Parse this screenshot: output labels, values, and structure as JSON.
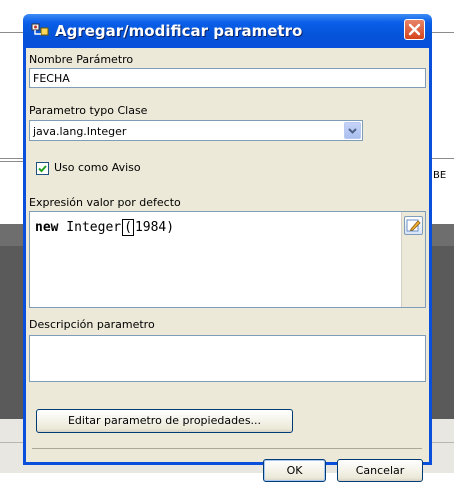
{
  "background": {
    "side_text": "BE"
  },
  "dialog": {
    "title": "Agregar/modificar parametro",
    "close_icon": "close-icon",
    "param_name": {
      "label": "Nombre Parámetro",
      "value": "FECHA"
    },
    "param_type": {
      "label": "Parametro typo Clase",
      "value": "java.lang.Integer"
    },
    "use_as_alert": {
      "label": "Uso como Aviso",
      "checked": true
    },
    "default_expr": {
      "label": "Expresión valor por defecto",
      "keyword": "new",
      "before_caret": " Integer",
      "caret_char": "(",
      "after_caret": "1984)"
    },
    "description": {
      "label": "Descripción parametro",
      "value": ""
    },
    "edit_properties_label": "Editar parametro de propiedades...",
    "ok_label": "OK",
    "cancel_label": "Cancelar"
  },
  "colors": {
    "titlebar": "#0a4fdc",
    "dialog_bg": "#ece9d8",
    "field_border": "#7f9db9"
  }
}
